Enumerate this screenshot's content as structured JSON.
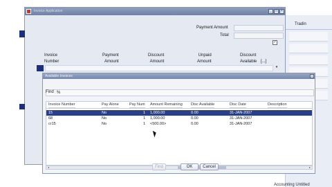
{
  "background": {
    "trade_label": "Tradin",
    "footer_text": "Accounting   Untitled"
  },
  "window": {
    "title": "Invoice Application",
    "payment_amount_label": "Payment Amount",
    "total_label": "Total",
    "checkbox_checked": "✓",
    "columns": [
      "Invoice\nNumber",
      "Payment\nAmount",
      "Discount\nAmount",
      "Unpaid\nAmount",
      "Discount\nAvailable"
    ],
    "ellipsis": "[...]"
  },
  "dialog": {
    "title": "Available Invoices",
    "find_label": "Find",
    "find_value": "%",
    "columns": [
      "Invoice Number",
      "Pay Alone",
      "Pay Num",
      "Amount Remaining",
      "Disc Available",
      "Disc Date",
      "Description"
    ],
    "rows": [
      {
        "invoice": "15",
        "pay_alone": "No",
        "pay_num": "1",
        "amount": "1,000.00",
        "disc": "0.00",
        "date": "31-JAN-2007",
        "desc": "",
        "selected": true
      },
      {
        "invoice": "68",
        "pay_alone": "No",
        "pay_num": "1",
        "amount": "1,000.00",
        "disc": "0.00",
        "date": "31-JAN-2007",
        "desc": "",
        "selected": false
      },
      {
        "invoice": "cr15",
        "pay_alone": "No",
        "pay_num": "1",
        "amount": "<500.00>",
        "disc": "0.00",
        "date": "31-JAN-2007",
        "desc": "",
        "selected": false
      }
    ],
    "buttons": {
      "find": "Find",
      "ok": "OK",
      "cancel": "Cancel"
    }
  },
  "colors": {
    "selection": "#293f8a",
    "title_bar": "#7487ad",
    "window_bg": "#e4e9f2"
  }
}
